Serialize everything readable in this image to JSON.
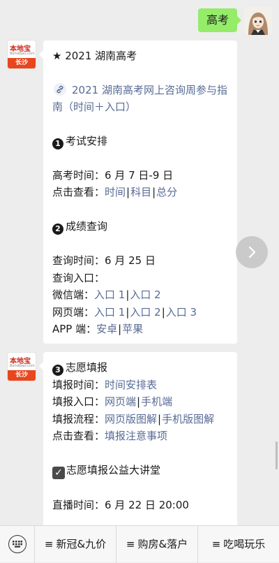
{
  "outgoing_message": "高考",
  "bot": {
    "brand": "本地宝",
    "site": "Bendibao.com",
    "city": "长沙"
  },
  "message1": {
    "title": "★ 2021 湖南高考",
    "article_link": "2021 湖南高考网上咨询周参与指南（时间＋入口）",
    "section1": {
      "number": "1",
      "title": "考试安排"
    },
    "exam_time_label": "高考时间：",
    "exam_time_value": "6 月 7 日-9 日",
    "check_label": "点击查看：",
    "check_links": [
      "时间",
      "科目",
      "总分"
    ],
    "section2": {
      "number": "2",
      "title": "成绩查询"
    },
    "query_time_label": "查询时间：",
    "query_time_value": "6 月 25 日",
    "query_entry_label": "查询入口：",
    "wechat_label": "微信端：",
    "wechat_links": [
      "入口 1",
      "入口 2"
    ],
    "web_label": "网页端：",
    "web_links": [
      "入口 1",
      "入口 2",
      "入口 3"
    ],
    "app_label": "APP 端：",
    "app_links": [
      "安卓",
      "苹果"
    ]
  },
  "message2": {
    "section3": {
      "number": "3",
      "title": "志愿填报"
    },
    "fill_time_label": "填报时间：",
    "fill_time_link": "时间安排表",
    "fill_entry_label": "填报入口：",
    "fill_entry_links": [
      "网页端",
      "手机端"
    ],
    "fill_flow_label": "填报流程：",
    "fill_flow_links": [
      "网页版图解",
      "手机版图解"
    ],
    "check_label": "点击查看：",
    "notes_link": "填报注意事项",
    "lecture_title": "志愿填报公益大讲堂",
    "live_time_label": "直播时间：",
    "live_time_value": "6 月 22 日 20:00"
  },
  "menu": {
    "items": [
      "新冠&九价",
      "购房&落户",
      "吃喝玩乐"
    ]
  },
  "icons": {
    "keyboard": "keyboard-icon",
    "next": "chevron-right-icon",
    "link": "link-chain-icon",
    "check": "checkbox-checked-icon",
    "menu": "hamburger-icon"
  },
  "colors": {
    "link": "#576b95",
    "outgoing_bubble": "#95ec69",
    "background": "#ededed",
    "brand_red": "#e8461e"
  }
}
